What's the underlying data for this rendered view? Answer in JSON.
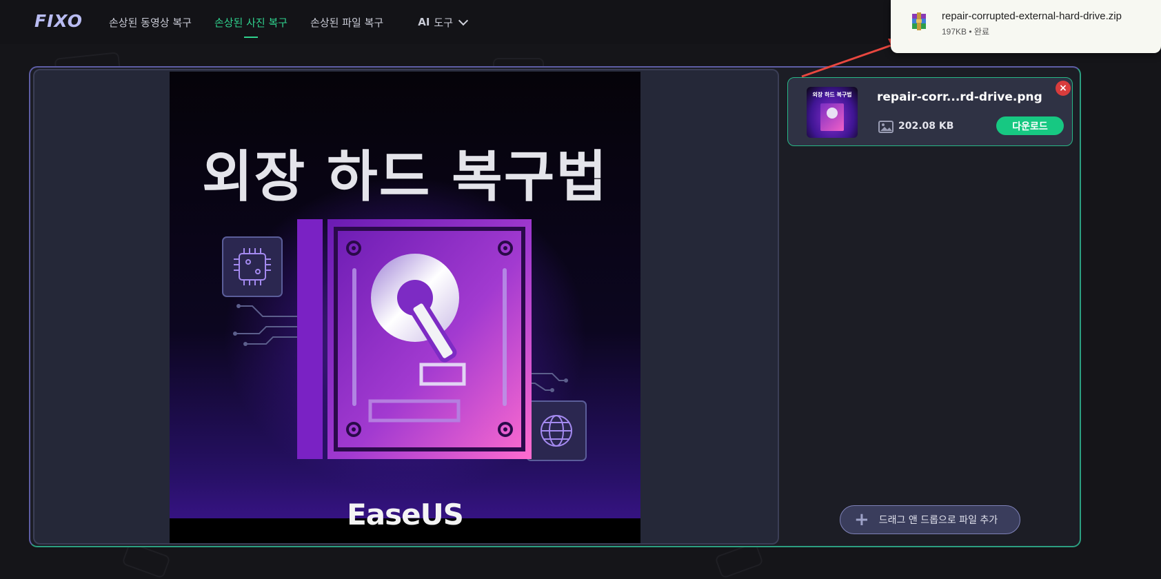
{
  "header": {
    "logo": "FIXO",
    "nav": [
      {
        "label": "손상된 동영상 복구",
        "active": false
      },
      {
        "label": "손상된 사진 복구",
        "active": true
      },
      {
        "label": "손상된 파일 복구",
        "active": false
      }
    ],
    "ai_menu": {
      "prefix": "AI",
      "label": "도구"
    }
  },
  "preview": {
    "title": "외장 하드 복구법",
    "brand": "EaseUS"
  },
  "file": {
    "thumb_title": "외장 하드 복구법",
    "name": "repair-corr...rd-drive.png",
    "size": "202.08 KB",
    "download_label": "다운로드",
    "close_label": "×"
  },
  "add_files": {
    "plus": "+",
    "label": "드래그 앤 드롭으로 파일 추가"
  },
  "download_popup": {
    "filename": "repair-corrupted-external-hard-drive.zip",
    "size": "197KB",
    "separator": "•",
    "status": "완료"
  },
  "colors": {
    "accent_green": "#17c882",
    "nav_active": "#2fd28e",
    "close_red": "#d83c3c",
    "annotation_arrow": "#e8473f"
  }
}
